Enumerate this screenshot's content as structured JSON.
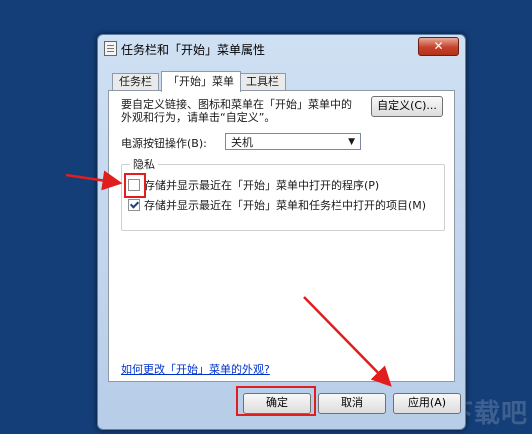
{
  "dialog": {
    "title": "任务栏和「开始」菜单属性",
    "close_symbol": "✕"
  },
  "tabs": [
    {
      "label": "任务栏",
      "active": false
    },
    {
      "label": "「开始」菜单",
      "active": true
    },
    {
      "label": "工具栏",
      "active": false
    }
  ],
  "start_menu": {
    "description_line1": "要自定义链接、图标和菜单在「开始」菜单中的",
    "description_line2": "外观和行为，请单击“自定义”。",
    "customize_button": "自定义(C)...",
    "power_label": "电源按钮操作(B):",
    "power_value": "关机",
    "privacy_legend": "隐私",
    "store_recent_programs": {
      "label": "存储并显示最近在「开始」菜单中打开的程序(P)",
      "checked": false
    },
    "store_recent_items": {
      "label": "存储并显示最近在「开始」菜单和任务栏中打开的项目(M)",
      "checked": true
    },
    "help_link": "如何更改「开始」菜单的外观?"
  },
  "buttons": {
    "ok": "确定",
    "cancel": "取消",
    "apply": "应用(A)"
  },
  "highlight_color": "#e01e1e",
  "watermark": "下载吧"
}
